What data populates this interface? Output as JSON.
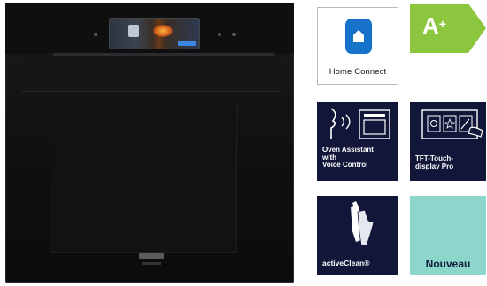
{
  "product": {
    "oven_label": "oven-with-tft-display"
  },
  "badges": {
    "home_connect": {
      "label": "Home Connect",
      "color": "#1673c9"
    },
    "energy_class": {
      "rating": "A",
      "plus": "+",
      "color": "#8cc63f"
    },
    "oven_assistant": {
      "line1": "Oven Assistant",
      "line2": "with",
      "line3": "Voice Control"
    },
    "tft_display": {
      "line1": "TFT-Touch-",
      "line2": "display Pro"
    },
    "active_clean": {
      "label": "activeClean®"
    },
    "nouveau": {
      "label": "Nouveau",
      "color": "#8dd6cc"
    }
  },
  "colors": {
    "tile_navy": "#12173a",
    "oven_body": "#0f0f10"
  }
}
